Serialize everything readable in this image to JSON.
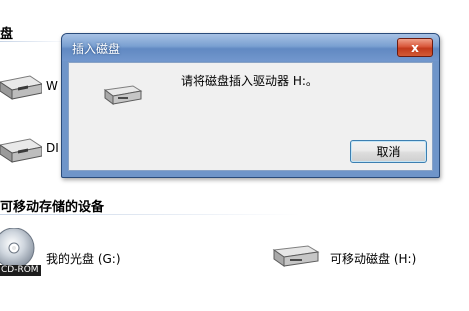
{
  "explorer": {
    "top_section_header": "盘",
    "drives": [
      {
        "label": "W",
        "icon": "hard-drive-icon"
      },
      {
        "label": "DI",
        "icon": "hard-drive-icon"
      }
    ],
    "removable_section_header": "可移动存储的设备",
    "removable": [
      {
        "label": "我的光盘 (G:)",
        "icon": "cd-rom-icon",
        "badge": "CD-ROM"
      },
      {
        "label": "可移动磁盘 (H:)",
        "icon": "removable-drive-icon"
      }
    ]
  },
  "dialog": {
    "title": "插入磁盘",
    "close_glyph": "x",
    "message": "请将磁盘插入驱动器 H:。",
    "cancel_label": "取消"
  }
}
